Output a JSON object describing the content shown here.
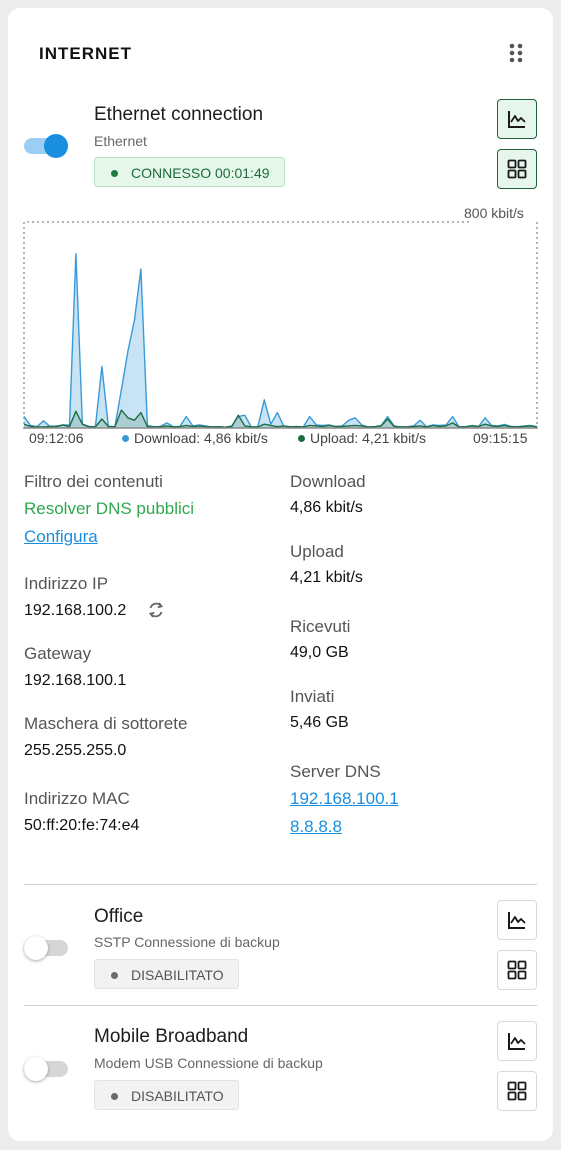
{
  "widget": {
    "title": "INTERNET",
    "menu_icon": "drag-dots-icon"
  },
  "primary": {
    "name": "Ethernet connection",
    "type": "Ethernet",
    "enabled": true,
    "status": "CONNESSO 00:01:49",
    "status_color": "#1d7a42"
  },
  "chart": {
    "scale_label": "800 kbit/s",
    "start_time": "09:12:06",
    "end_time": "09:15:15",
    "download_legend": "Download: 4,86 kbit/s",
    "upload_legend": "Upload: 4,21 kbit/s"
  },
  "chart_data": {
    "type": "area",
    "ylim": [
      0,
      800
    ],
    "series": [
      {
        "name": "Download",
        "color": "#3a9ad9",
        "values": [
          45,
          10,
          5,
          28,
          6,
          8,
          12,
          12,
          680,
          15,
          6,
          5,
          240,
          6,
          5,
          150,
          300,
          420,
          620,
          10,
          5,
          6,
          20,
          5,
          6,
          45,
          8,
          12,
          8,
          4,
          5,
          3,
          8,
          45,
          50,
          4,
          5,
          110,
          15,
          60,
          8,
          5,
          6,
          4,
          45,
          12,
          10,
          12,
          6,
          8,
          30,
          40,
          12,
          4,
          5,
          10,
          45,
          8,
          4,
          5,
          8,
          30,
          5,
          12,
          10,
          12,
          45,
          4,
          5,
          10,
          6,
          40,
          10,
          8,
          14,
          6,
          5,
          8,
          10,
          5
        ]
      },
      {
        "name": "Upload",
        "color": "#1f6e43",
        "values": [
          15,
          6,
          4,
          4,
          6,
          5,
          12,
          5,
          65,
          15,
          5,
          4,
          35,
          6,
          5,
          70,
          40,
          30,
          60,
          5,
          4,
          5,
          8,
          4,
          5,
          10,
          6,
          8,
          5,
          4,
          5,
          3,
          6,
          50,
          8,
          4,
          4,
          15,
          10,
          5,
          8,
          4,
          5,
          4,
          10,
          8,
          6,
          10,
          5,
          6,
          8,
          10,
          8,
          4,
          5,
          8,
          35,
          6,
          4,
          4,
          6,
          8,
          4,
          10,
          6,
          8,
          20,
          4,
          5,
          8,
          6,
          15,
          8,
          6,
          10,
          5,
          4,
          6,
          8,
          4
        ]
      }
    ]
  },
  "details_left": {
    "filter_label": "Filtro dei contenuti",
    "filter_value": "Resolver DNS pubblici",
    "configure_link": "Configura",
    "ip_label": "Indirizzo IP",
    "ip_value": "192.168.100.2",
    "gateway_label": "Gateway",
    "gateway_value": "192.168.100.1",
    "mask_label": "Maschera di sottorete",
    "mask_value": "255.255.255.0",
    "mac_label": "Indirizzo MAC",
    "mac_value": "50:ff:20:fe:74:e4"
  },
  "details_right": {
    "download_label": "Download",
    "download_value": "4,86 kbit/s",
    "upload_label": "Upload",
    "upload_value": "4,21 kbit/s",
    "received_label": "Ricevuti",
    "received_value": "49,0 GB",
    "sent_label": "Inviati",
    "sent_value": "5,46 GB",
    "dns_label": "Server DNS",
    "dns_1": "192.168.100.1",
    "dns_2": "8.8.8.8"
  },
  "backups": [
    {
      "name": "Office",
      "subtitle": "SSTP Connessione di backup",
      "enabled": false,
      "status": "DISABILITATO"
    },
    {
      "name": "Mobile Broadband",
      "subtitle": "Modem USB Connessione di backup",
      "enabled": false,
      "status": "DISABILITATO"
    }
  ],
  "colors": {
    "accent": "#1a8fe0",
    "link_green": "#2fa84f",
    "connected_green": "#1d7a42"
  }
}
